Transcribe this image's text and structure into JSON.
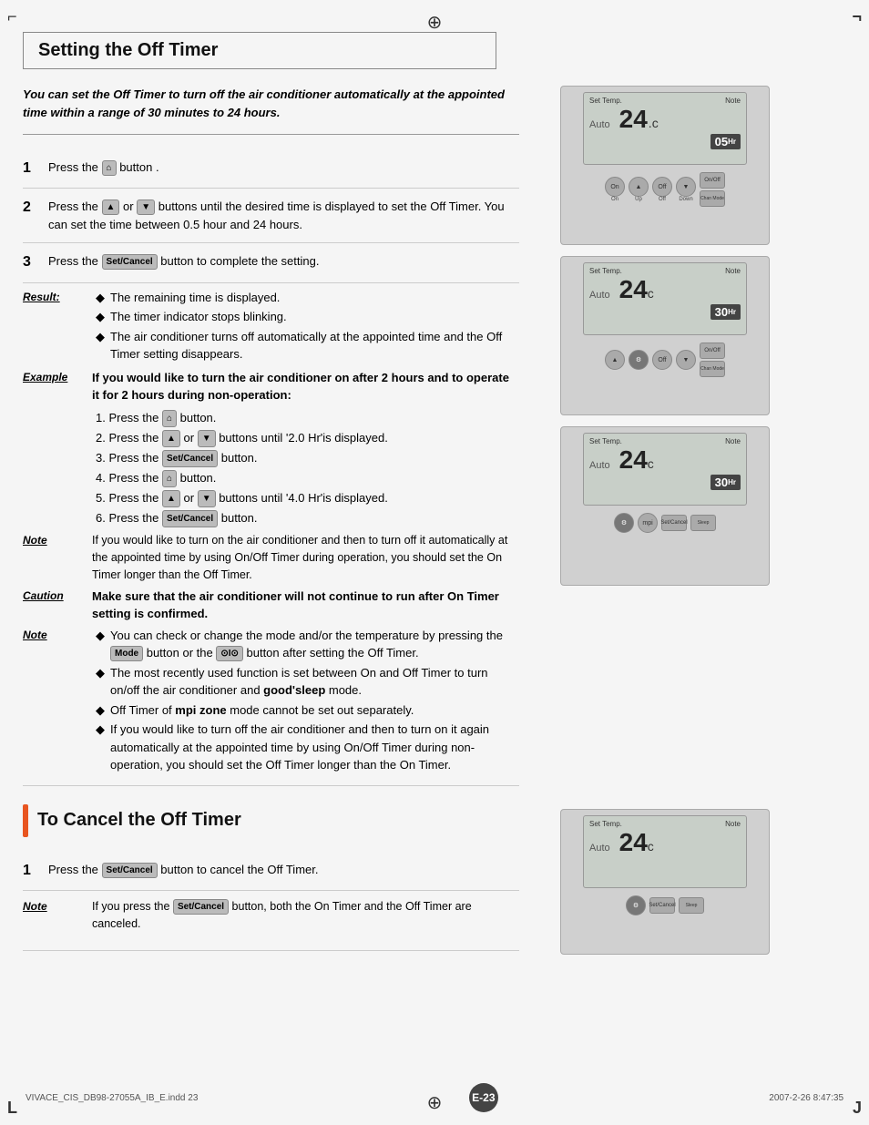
{
  "page": {
    "title": "Setting the Off Timer",
    "cancel_title": "To Cancel the Off Timer",
    "page_number": "E-23",
    "file_info": "VIVACE_CIS_DB98-27055A_IB_E.indd   23",
    "date_info": "2007-2-26   8:47:35"
  },
  "intro": {
    "text": "You can set the Off Timer to turn off the air conditioner automatically at the appointed time within a range of 30 minutes to 24 hours."
  },
  "steps": [
    {
      "num": "1",
      "text": "Press the  button ."
    },
    {
      "num": "2",
      "text": "Press the  or  buttons until the desired time is displayed to set the Off Timer. You can set the time between 0.5 hour and 24 hours."
    },
    {
      "num": "3",
      "text": "Press the  button to complete the setting."
    }
  ],
  "result": {
    "label": "Result:",
    "bullets": [
      "The remaining time is displayed.",
      "The timer indicator stops blinking.",
      "The air conditioner turns off automatically at the appointed time and the Off Timer setting disappears."
    ]
  },
  "example": {
    "label": "Example",
    "heading": "If you would like to turn the air conditioner on after 2 hours and to operate it for 2 hours during non-operation:",
    "steps": [
      "1. Press the  button.",
      "2. Press the  or  buttons until '2.0 Hr'is displayed.",
      "3. Press the  button.",
      "4. Press the  button.",
      "5. Press the  or  buttons until '4.0 Hr'is displayed.",
      "6. Press the  button."
    ]
  },
  "note1": {
    "label": "Note",
    "text": "If you would like to turn on the air conditioner and then to turn off it automatically at the appointed time by using On/Off Timer during operation, you should set the On Timer longer than the Off Timer."
  },
  "caution": {
    "label": "Caution",
    "text": "Make sure that the air conditioner will not continue to run after On Timer setting is confirmed."
  },
  "note2": {
    "label": "Note",
    "bullets": [
      "You can check or change the mode and/or the temperature by pressing the  button or the  button after setting the Off Timer.",
      "The most recently used function is set between On and Off Timer to turn on/off the air conditioner and good'sleep mode.",
      "Off Timer of mpi zone mode cannot be set out separately.",
      "If you would like to turn off the air conditioner and then to turn on it again automatically at the appointed time by using On/Off Timer during non-operation, you should set the Off Timer longer than the On Timer."
    ]
  },
  "cancel_section": {
    "step1": {
      "num": "1",
      "text": "Press the  button to cancel the Off Timer."
    },
    "note": {
      "label": "Note",
      "text": "If you press the  button, both the On Timer and the Off Timer are canceled."
    }
  },
  "remotes": {
    "r1": {
      "temp": "24",
      "unit": "c",
      "timer_val": "05",
      "timer_sub": "Hr",
      "mode": "Auto"
    },
    "r2": {
      "temp": "24",
      "unit": "c",
      "timer_val": "30",
      "timer_sub": "Hr",
      "mode": "Auto"
    },
    "r3": {
      "temp": "24",
      "unit": "c",
      "timer_val": "30",
      "timer_sub": "Hr",
      "mode": "Auto"
    },
    "r4": {
      "temp": "24",
      "unit": "c",
      "mode": "Auto"
    }
  }
}
